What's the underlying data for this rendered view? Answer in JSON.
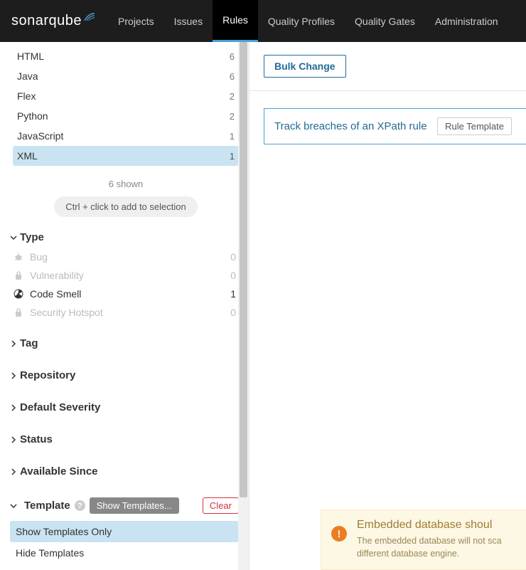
{
  "nav": {
    "logo": "sonarqube",
    "items": [
      "Projects",
      "Issues",
      "Rules",
      "Quality Profiles",
      "Quality Gates",
      "Administration"
    ],
    "active_index": 2
  },
  "sidebar": {
    "languages": [
      {
        "name": "HTML",
        "count": 6,
        "selected": false
      },
      {
        "name": "Java",
        "count": 6,
        "selected": false
      },
      {
        "name": "Flex",
        "count": 2,
        "selected": false
      },
      {
        "name": "Python",
        "count": 2,
        "selected": false
      },
      {
        "name": "JavaScript",
        "count": 1,
        "selected": false
      },
      {
        "name": "XML",
        "count": 1,
        "selected": true
      }
    ],
    "shown_note": "6 shown",
    "selection_hint": "Ctrl + click to add to selection",
    "sections": {
      "type": {
        "label": "Type",
        "expanded": true,
        "items": [
          {
            "icon": "bug",
            "label": "Bug",
            "count": 0,
            "active": false
          },
          {
            "icon": "lock",
            "label": "Vulnerability",
            "count": 0,
            "active": false
          },
          {
            "icon": "radiation",
            "label": "Code Smell",
            "count": 1,
            "active": true
          },
          {
            "icon": "lock",
            "label": "Security Hotspot",
            "count": 0,
            "active": false
          }
        ]
      },
      "tag": {
        "label": "Tag",
        "expanded": false
      },
      "repository": {
        "label": "Repository",
        "expanded": false
      },
      "default_severity": {
        "label": "Default Severity",
        "expanded": false
      },
      "status": {
        "label": "Status",
        "expanded": false
      },
      "available_since": {
        "label": "Available Since",
        "expanded": false
      },
      "template": {
        "label": "Template",
        "expanded": true,
        "selected_pill": "Show Templates...",
        "clear_label": "Clear",
        "options": [
          {
            "label": "Show Templates Only",
            "selected": true
          },
          {
            "label": "Hide Templates",
            "selected": false
          }
        ]
      }
    }
  },
  "content": {
    "bulk_change_label": "Bulk Change",
    "rule": {
      "title": "Track breaches of an XPath rule",
      "badge": "Rule Template"
    },
    "warning": {
      "title": "Embedded database shoul",
      "body_line1": "The embedded database will not sca",
      "body_line2": "different database engine."
    }
  }
}
